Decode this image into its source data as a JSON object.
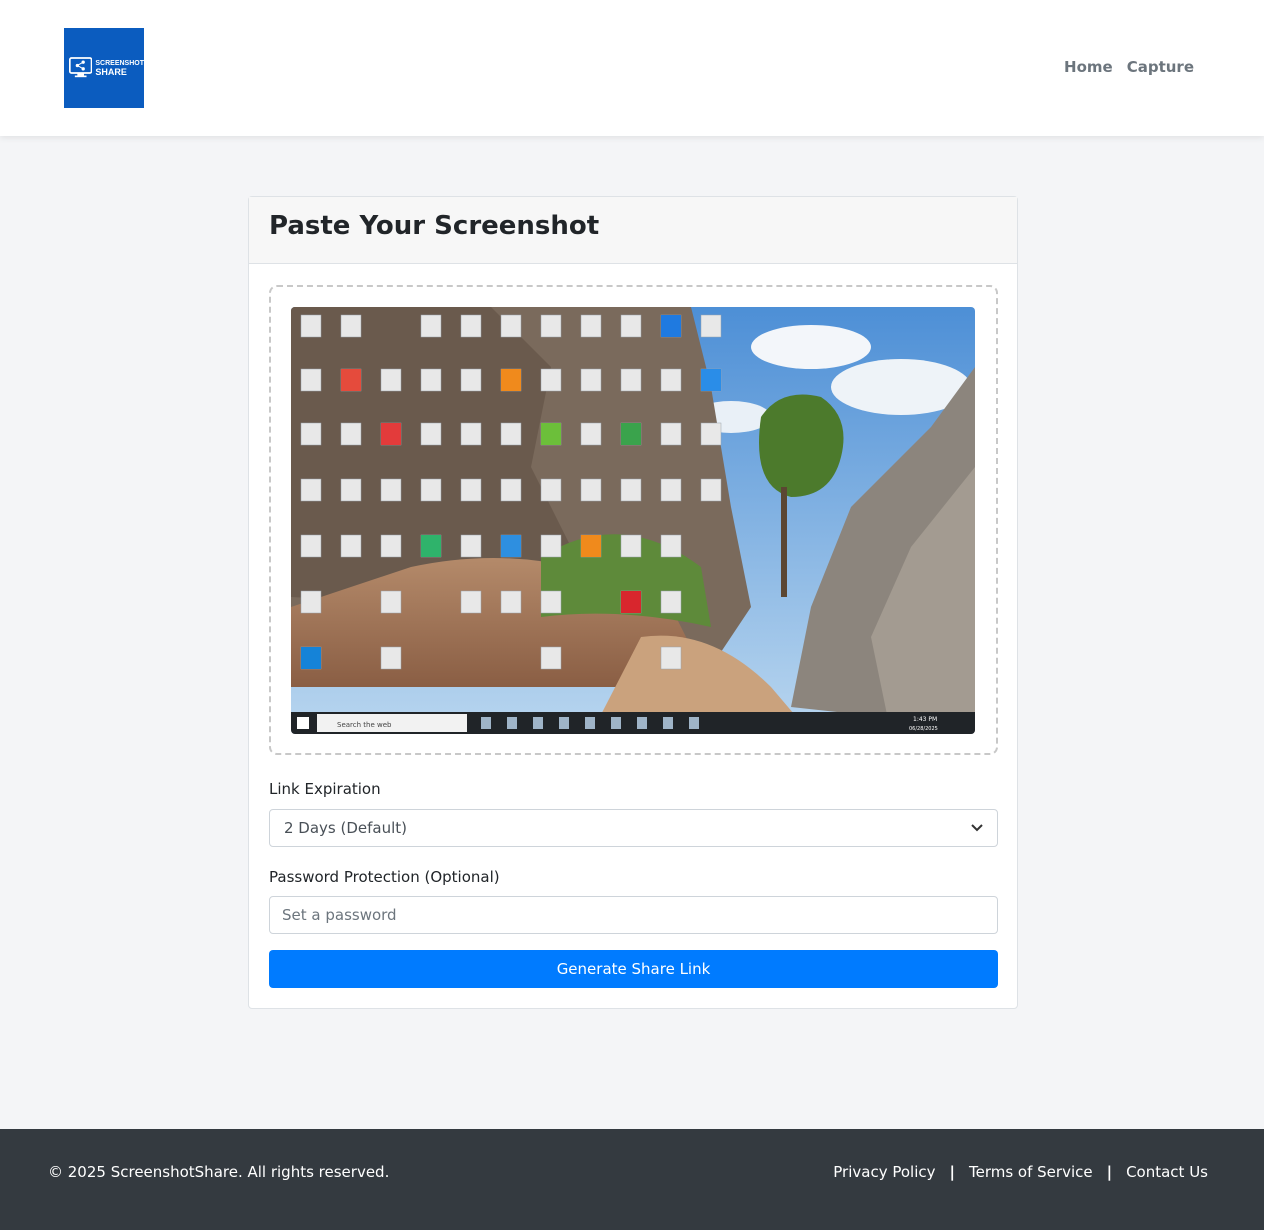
{
  "brand": {
    "logo_line1": "SCREENSHOT",
    "logo_line2": "SHARE",
    "color": "#0b5cbf"
  },
  "nav": {
    "home": "Home",
    "capture": "Capture"
  },
  "card": {
    "title": "Paste Your Screenshot"
  },
  "preview": {
    "taskbar_search": "Search the web",
    "clock_time": "1:43 PM",
    "clock_date": "06/28/2025"
  },
  "form": {
    "expiration_label": "Link Expiration",
    "expiration_selected": "2 Days (Default)",
    "password_label": "Password Protection (Optional)",
    "password_placeholder": "Set a password",
    "password_value": "",
    "submit_label": "Generate Share Link",
    "accent": "#007bff"
  },
  "footer": {
    "copyright": "© 2025 ScreenshotShare. All rights reserved.",
    "links": [
      "Privacy Policy",
      "Terms of Service",
      "Contact Us"
    ],
    "separator": "|"
  }
}
